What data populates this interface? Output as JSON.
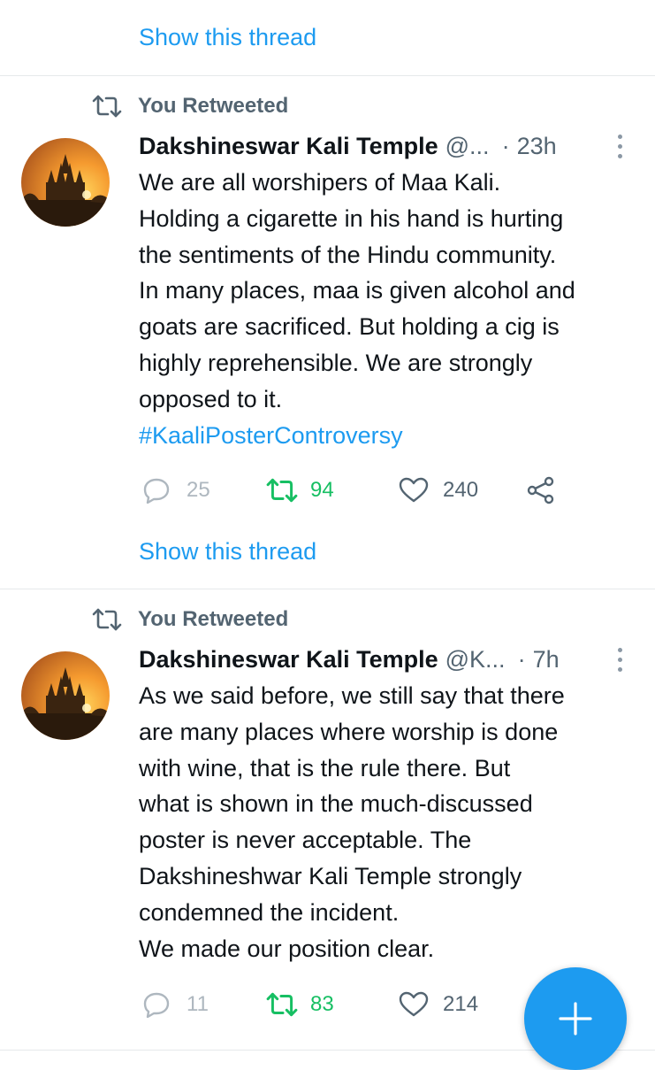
{
  "top": {
    "show_thread": "Show this thread"
  },
  "tweets": [
    {
      "retweet_label": "You Retweeted",
      "name": "Dakshineswar Kali Temple",
      "handle": "@...",
      "separator": "·",
      "time": "23h",
      "lines": [
        "We are all worshipers of Maa Kali.",
        "Holding a cigarette in his hand is hurting",
        "the sentiments of the Hindu community.",
        "In many places, maa is given alcohol and",
        "goats are sacrificed. But holding a cig is",
        "highly reprehensible. We are strongly",
        "opposed to it."
      ],
      "hashtag": "#KaaliPosterControversy",
      "replies": "25",
      "retweets": "94",
      "likes": "240",
      "show_thread": "Show this thread"
    },
    {
      "retweet_label": "You Retweeted",
      "name": "Dakshineswar Kali Temple",
      "handle": "@K...",
      "separator": "·",
      "time": "7h",
      "lines": [
        "As we said before, we still say that there",
        "are many places where worship is done",
        "with wine, that is the rule there. But",
        "what is shown in the much-discussed",
        "poster is never acceptable. The",
        "Dakshineshwar Kali Temple strongly",
        "condemned the incident.",
        "We made our position clear."
      ],
      "replies": "11",
      "retweets": "83",
      "likes": "214"
    }
  ],
  "icons": {
    "retweet": "retweet-icon",
    "reply": "reply-icon",
    "like": "heart-icon",
    "share": "share-icon",
    "more": "more-vertical-icon",
    "compose": "plus-icon"
  },
  "colors": {
    "link": "#1d9bf0",
    "retweet_active": "#17bf63",
    "secondary_text": "#536471",
    "fab": "#1d9bf0"
  }
}
